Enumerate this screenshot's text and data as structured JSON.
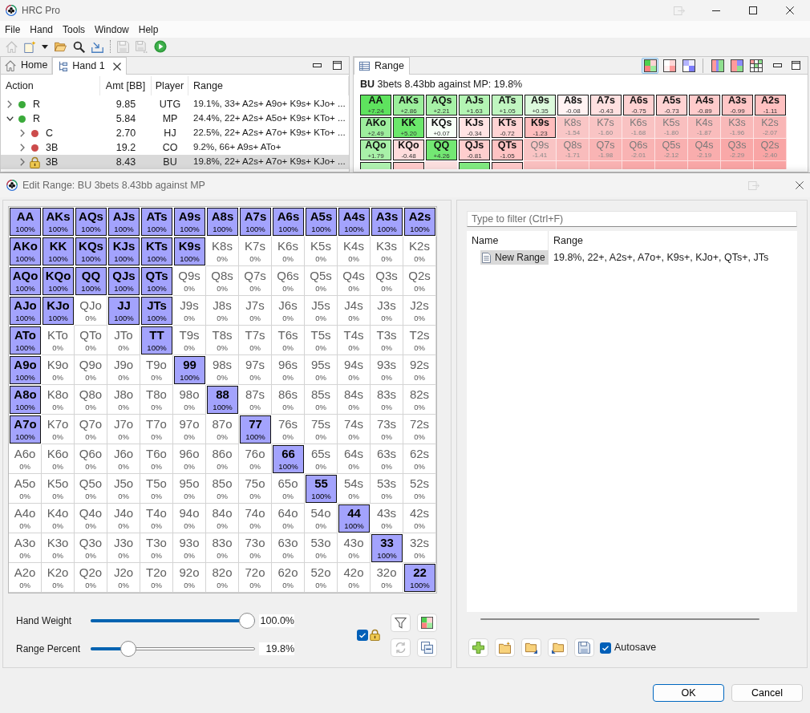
{
  "window": {
    "title": "HRC Pro"
  },
  "menu": [
    "File",
    "Hand",
    "Tools",
    "Window",
    "Help"
  ],
  "toolbar": [
    [
      {
        "kind": "home",
        "disabled": true
      },
      {
        "kind": "new",
        "disabled": false
      },
      {
        "kind": "menu-arrow",
        "disabled": false
      },
      {
        "kind": "open",
        "disabled": false
      },
      {
        "kind": "search",
        "disabled": false
      },
      {
        "kind": "import",
        "disabled": false
      }
    ],
    [
      {
        "kind": "save",
        "disabled": true
      },
      {
        "kind": "save-all",
        "disabled": true
      },
      {
        "kind": "run",
        "disabled": false
      }
    ]
  ],
  "hand_panel": {
    "tabs": [
      {
        "label": "Home",
        "kind": "home",
        "selected": false,
        "closable": false
      },
      {
        "label": "Hand 1",
        "kind": "tree",
        "selected": true,
        "closable": true
      }
    ],
    "columns": [
      "Action",
      "Amt [BB]",
      "Player",
      "Range"
    ],
    "rows": [
      {
        "action": "R",
        "amount": "9.85",
        "player": "UTG",
        "range": "19.1%, 33+ A2s+ A9o+ K9s+ KJo+ ...",
        "kind": "dot",
        "color": "#3aaa3a",
        "expanded": false,
        "selected": false
      },
      {
        "action": "R",
        "amount": "5.84",
        "player": "MP",
        "range": "24.4%, 22+ A2s+ A5o+ K9s+ KTo+ ...",
        "kind": "dot",
        "color": "#3aaa3a",
        "expanded": true,
        "selected": false,
        "children": [
          {
            "action": "C",
            "amount": "2.70",
            "player": "HJ",
            "range": "22.5%, 22+ A2s+ A7o+ K9s+ KTo+ ...",
            "kind": "dot",
            "color": "#cc4b4b",
            "expanded": false,
            "selected": false
          },
          {
            "action": "3B",
            "amount": "19.2",
            "player": "CO",
            "range": "9.2%, 66+ A9s+ ATo+",
            "kind": "dot",
            "color": "#cc4b4b",
            "expanded": false,
            "selected": false
          },
          {
            "action": "3B",
            "amount": "8.43",
            "player": "BU",
            "range": "19.8%, 22+ A2s+ A7o+ K9s+ KJo+ ...",
            "kind": "lock",
            "expanded": false,
            "selected": true
          }
        ]
      }
    ]
  },
  "range_panel": {
    "tab": {
      "label": "Range",
      "kind": "table",
      "selected": true
    },
    "view_groups": [
      [
        {
          "kind": "ev",
          "selected": true
        },
        {
          "kind": "frequency",
          "selected": false
        },
        {
          "kind": "weight",
          "selected": false
        }
      ],
      [
        {
          "kind": "split",
          "selected": false
        },
        {
          "kind": "compare",
          "selected": false
        },
        {
          "kind": "matrix",
          "selected": false
        }
      ]
    ],
    "headline": "**BU** 3bets 8.43bb against MP: 19.8%",
    "grid": [
      [
        {
          "hand": "AA",
          "ev": "+7.24",
          "in_range": true,
          "color": "#5ee35e"
        },
        {
          "hand": "AKs",
          "ev": "+2.86",
          "in_range": true,
          "color": "#9bef9b"
        },
        {
          "hand": "AQs",
          "ev": "+2.21",
          "in_range": true,
          "color": "#a6f1a6"
        },
        {
          "hand": "AJs",
          "ev": "+1.63",
          "in_range": true,
          "color": "#b3f4b3"
        },
        {
          "hand": "ATs",
          "ev": "+1.05",
          "in_range": true,
          "color": "#c0f6c0"
        },
        {
          "hand": "A9s",
          "ev": "+0.35",
          "in_range": true,
          "color": "#dcfadc"
        },
        {
          "hand": "A8s",
          "ev": "-0.08",
          "in_range": true,
          "color": "#fff2f2"
        },
        {
          "hand": "A7s",
          "ev": "-0.43",
          "in_range": true,
          "color": "#ffe0e0"
        },
        {
          "hand": "A6s",
          "ev": "-0.75",
          "in_range": true,
          "color": "#ffd2d2"
        },
        {
          "hand": "A5s",
          "ev": "-0.73",
          "in_range": true,
          "color": "#ffd3d3"
        },
        {
          "hand": "A4s",
          "ev": "-0.89",
          "in_range": true,
          "color": "#ffcbcb"
        },
        {
          "hand": "A3s",
          "ev": "-0.99",
          "in_range": true,
          "color": "#ffc6c6"
        },
        {
          "hand": "A2s",
          "ev": "-1.11",
          "in_range": true,
          "color": "#ffc1c1"
        }
      ],
      [
        {
          "hand": "AKo",
          "ev": "+2.49",
          "in_range": true,
          "color": "#9eef9e"
        },
        {
          "hand": "KK",
          "ev": "+5.20",
          "in_range": true,
          "color": "#6be86b"
        },
        {
          "hand": "KQs",
          "ev": "+0.07",
          "in_range": true,
          "color": "#f6fff6"
        },
        {
          "hand": "KJs",
          "ev": "-0.34",
          "in_range": true,
          "color": "#ffe4e4"
        },
        {
          "hand": "KTs",
          "ev": "-0.72",
          "in_range": true,
          "color": "#ffd4d4"
        },
        {
          "hand": "K9s",
          "ev": "-1.23",
          "in_range": true,
          "color": "#ffbdbd"
        },
        {
          "hand": "K8s",
          "ev": "-1.54",
          "in_range": false,
          "color": "#f9c6c6"
        },
        {
          "hand": "K7s",
          "ev": "-1.60",
          "in_range": false,
          "color": "#f9c4c4"
        },
        {
          "hand": "K6s",
          "ev": "-1.68",
          "in_range": false,
          "color": "#f9c2c2"
        },
        {
          "hand": "K5s",
          "ev": "-1.80",
          "in_range": false,
          "color": "#f9bfbf"
        },
        {
          "hand": "K4s",
          "ev": "-1.87",
          "in_range": false,
          "color": "#f9bcbc"
        },
        {
          "hand": "K3s",
          "ev": "-1.96",
          "in_range": false,
          "color": "#f9b9b9"
        },
        {
          "hand": "K2s",
          "ev": "-2.07",
          "in_range": false,
          "color": "#f9b6b6"
        }
      ],
      [
        {
          "hand": "AQo",
          "ev": "+1.79",
          "in_range": true,
          "color": "#a8f1a8"
        },
        {
          "hand": "KQo",
          "ev": "-0.48",
          "in_range": true,
          "color": "#ffdcdc"
        },
        {
          "hand": "QQ",
          "ev": "+4.26",
          "in_range": true,
          "color": "#73e873"
        },
        {
          "hand": "QJs",
          "ev": "-0.81",
          "in_range": true,
          "color": "#ffcece"
        },
        {
          "hand": "QTs",
          "ev": "-1.05",
          "in_range": true,
          "color": "#ffc3c3"
        },
        {
          "hand": "Q9s",
          "ev": "-1.41",
          "in_range": false,
          "color": "#f9c4c4"
        },
        {
          "hand": "Q8s",
          "ev": "-1.71",
          "in_range": false,
          "color": "#f9bcbc"
        },
        {
          "hand": "Q7s",
          "ev": "-1.98",
          "in_range": false,
          "color": "#f9b4b4"
        },
        {
          "hand": "Q6s",
          "ev": "-2.01",
          "in_range": false,
          "color": "#f9b3b3"
        },
        {
          "hand": "Q5s",
          "ev": "-2.12",
          "in_range": false,
          "color": "#f9b0b0"
        },
        {
          "hand": "Q4s",
          "ev": "-2.19",
          "in_range": false,
          "color": "#f9adad"
        },
        {
          "hand": "Q3s",
          "ev": "-2.29",
          "in_range": false,
          "color": "#f9a8a8"
        },
        {
          "hand": "Q2s",
          "ev": "-2.40",
          "in_range": false,
          "color": "#f9a5a5"
        }
      ],
      [
        {
          "in_range": true,
          "color": "#b0f2b0"
        },
        {
          "in_range": true,
          "color": "#ffcaca"
        },
        {
          "in_range": false,
          "color": "#fbdede"
        },
        {
          "in_range": true,
          "color": "#80ea80"
        },
        {
          "in_range": true,
          "color": "#ffc8c8"
        },
        {
          "in_range": false,
          "color": "#f9bfbf"
        },
        {
          "in_range": false,
          "color": "#f9b8b8"
        },
        {
          "in_range": false,
          "color": "#f9b2b2"
        },
        {
          "in_range": false,
          "color": "#f9aaaa"
        },
        {
          "in_range": false,
          "color": "#f9aaaa"
        },
        {
          "in_range": false,
          "color": "#f9a7a7"
        },
        {
          "in_range": false,
          "color": "#f9a5a5"
        },
        {
          "in_range": false,
          "color": "#f9a3a3"
        }
      ]
    ]
  },
  "dialog": {
    "title": "Edit Range: BU 3bets 8.43bb against MP",
    "grid": [
      [
        {
          "hand": "AA",
          "weight": "100%",
          "selected": true
        },
        {
          "hand": "AKs",
          "weight": "100%",
          "selected": true
        },
        {
          "hand": "AQs",
          "weight": "100%",
          "selected": true
        },
        {
          "hand": "AJs",
          "weight": "100%",
          "selected": true
        },
        {
          "hand": "ATs",
          "weight": "100%",
          "selected": true
        },
        {
          "hand": "A9s",
          "weight": "100%",
          "selected": true
        },
        {
          "hand": "A8s",
          "weight": "100%",
          "selected": true
        },
        {
          "hand": "A7s",
          "weight": "100%",
          "selected": true
        },
        {
          "hand": "A6s",
          "weight": "100%",
          "selected": true
        },
        {
          "hand": "A5s",
          "weight": "100%",
          "selected": true
        },
        {
          "hand": "A4s",
          "weight": "100%",
          "selected": true
        },
        {
          "hand": "A3s",
          "weight": "100%",
          "selected": true
        },
        {
          "hand": "A2s",
          "weight": "100%",
          "selected": true
        }
      ],
      [
        {
          "hand": "AKo",
          "weight": "100%",
          "selected": true
        },
        {
          "hand": "KK",
          "weight": "100%",
          "selected": true
        },
        {
          "hand": "KQs",
          "weight": "100%",
          "selected": true
        },
        {
          "hand": "KJs",
          "weight": "100%",
          "selected": true
        },
        {
          "hand": "KTs",
          "weight": "100%",
          "selected": true
        },
        {
          "hand": "K9s",
          "weight": "100%",
          "selected": true
        },
        {
          "hand": "K8s",
          "weight": "0%",
          "selected": false
        },
        {
          "hand": "K7s",
          "weight": "0%",
          "selected": false
        },
        {
          "hand": "K6s",
          "weight": "0%",
          "selected": false
        },
        {
          "hand": "K5s",
          "weight": "0%",
          "selected": false
        },
        {
          "hand": "K4s",
          "weight": "0%",
          "selected": false
        },
        {
          "hand": "K3s",
          "weight": "0%",
          "selected": false
        },
        {
          "hand": "K2s",
          "weight": "0%",
          "selected": false
        }
      ],
      [
        {
          "hand": "AQo",
          "weight": "100%",
          "selected": true
        },
        {
          "hand": "KQo",
          "weight": "100%",
          "selected": true
        },
        {
          "hand": "QQ",
          "weight": "100%",
          "selected": true
        },
        {
          "hand": "QJs",
          "weight": "100%",
          "selected": true
        },
        {
          "hand": "QTs",
          "weight": "100%",
          "selected": true
        },
        {
          "hand": "Q9s",
          "weight": "0%",
          "selected": false
        },
        {
          "hand": "Q8s",
          "weight": "0%",
          "selected": false
        },
        {
          "hand": "Q7s",
          "weight": "0%",
          "selected": false
        },
        {
          "hand": "Q6s",
          "weight": "0%",
          "selected": false
        },
        {
          "hand": "Q5s",
          "weight": "0%",
          "selected": false
        },
        {
          "hand": "Q4s",
          "weight": "0%",
          "selected": false
        },
        {
          "hand": "Q3s",
          "weight": "0%",
          "selected": false
        },
        {
          "hand": "Q2s",
          "weight": "0%",
          "selected": false
        }
      ],
      [
        {
          "hand": "AJo",
          "weight": "100%",
          "selected": true
        },
        {
          "hand": "KJo",
          "weight": "100%",
          "selected": true
        },
        {
          "hand": "QJo",
          "weight": "0%",
          "selected": false
        },
        {
          "hand": "JJ",
          "weight": "100%",
          "selected": true
        },
        {
          "hand": "JTs",
          "weight": "100%",
          "selected": true
        },
        {
          "hand": "J9s",
          "weight": "0%",
          "selected": false
        },
        {
          "hand": "J8s",
          "weight": "0%",
          "selected": false
        },
        {
          "hand": "J7s",
          "weight": "0%",
          "selected": false
        },
        {
          "hand": "J6s",
          "weight": "0%",
          "selected": false
        },
        {
          "hand": "J5s",
          "weight": "0%",
          "selected": false
        },
        {
          "hand": "J4s",
          "weight": "0%",
          "selected": false
        },
        {
          "hand": "J3s",
          "weight": "0%",
          "selected": false
        },
        {
          "hand": "J2s",
          "weight": "0%",
          "selected": false
        }
      ],
      [
        {
          "hand": "ATo",
          "weight": "100%",
          "selected": true
        },
        {
          "hand": "KTo",
          "weight": "0%",
          "selected": false
        },
        {
          "hand": "QTo",
          "weight": "0%",
          "selected": false
        },
        {
          "hand": "JTo",
          "weight": "0%",
          "selected": false
        },
        {
          "hand": "TT",
          "weight": "100%",
          "selected": true
        },
        {
          "hand": "T9s",
          "weight": "0%",
          "selected": false
        },
        {
          "hand": "T8s",
          "weight": "0%",
          "selected": false
        },
        {
          "hand": "T7s",
          "weight": "0%",
          "selected": false
        },
        {
          "hand": "T6s",
          "weight": "0%",
          "selected": false
        },
        {
          "hand": "T5s",
          "weight": "0%",
          "selected": false
        },
        {
          "hand": "T4s",
          "weight": "0%",
          "selected": false
        },
        {
          "hand": "T3s",
          "weight": "0%",
          "selected": false
        },
        {
          "hand": "T2s",
          "weight": "0%",
          "selected": false
        }
      ],
      [
        {
          "hand": "A9o",
          "weight": "100%",
          "selected": true
        },
        {
          "hand": "K9o",
          "weight": "0%",
          "selected": false
        },
        {
          "hand": "Q9o",
          "weight": "0%",
          "selected": false
        },
        {
          "hand": "J9o",
          "weight": "0%",
          "selected": false
        },
        {
          "hand": "T9o",
          "weight": "0%",
          "selected": false
        },
        {
          "hand": "99",
          "weight": "100%",
          "selected": true
        },
        {
          "hand": "98s",
          "weight": "0%",
          "selected": false
        },
        {
          "hand": "97s",
          "weight": "0%",
          "selected": false
        },
        {
          "hand": "96s",
          "weight": "0%",
          "selected": false
        },
        {
          "hand": "95s",
          "weight": "0%",
          "selected": false
        },
        {
          "hand": "94s",
          "weight": "0%",
          "selected": false
        },
        {
          "hand": "93s",
          "weight": "0%",
          "selected": false
        },
        {
          "hand": "92s",
          "weight": "0%",
          "selected": false
        }
      ],
      [
        {
          "hand": "A8o",
          "weight": "100%",
          "selected": true
        },
        {
          "hand": "K8o",
          "weight": "0%",
          "selected": false
        },
        {
          "hand": "Q8o",
          "weight": "0%",
          "selected": false
        },
        {
          "hand": "J8o",
          "weight": "0%",
          "selected": false
        },
        {
          "hand": "T8o",
          "weight": "0%",
          "selected": false
        },
        {
          "hand": "98o",
          "weight": "0%",
          "selected": false
        },
        {
          "hand": "88",
          "weight": "100%",
          "selected": true
        },
        {
          "hand": "87s",
          "weight": "0%",
          "selected": false
        },
        {
          "hand": "86s",
          "weight": "0%",
          "selected": false
        },
        {
          "hand": "85s",
          "weight": "0%",
          "selected": false
        },
        {
          "hand": "84s",
          "weight": "0%",
          "selected": false
        },
        {
          "hand": "83s",
          "weight": "0%",
          "selected": false
        },
        {
          "hand": "82s",
          "weight": "0%",
          "selected": false
        }
      ],
      [
        {
          "hand": "A7o",
          "weight": "100%",
          "selected": true
        },
        {
          "hand": "K7o",
          "weight": "0%",
          "selected": false
        },
        {
          "hand": "Q7o",
          "weight": "0%",
          "selected": false
        },
        {
          "hand": "J7o",
          "weight": "0%",
          "selected": false
        },
        {
          "hand": "T7o",
          "weight": "0%",
          "selected": false
        },
        {
          "hand": "97o",
          "weight": "0%",
          "selected": false
        },
        {
          "hand": "87o",
          "weight": "0%",
          "selected": false
        },
        {
          "hand": "77",
          "weight": "100%",
          "selected": true
        },
        {
          "hand": "76s",
          "weight": "0%",
          "selected": false
        },
        {
          "hand": "75s",
          "weight": "0%",
          "selected": false
        },
        {
          "hand": "74s",
          "weight": "0%",
          "selected": false
        },
        {
          "hand": "73s",
          "weight": "0%",
          "selected": false
        },
        {
          "hand": "72s",
          "weight": "0%",
          "selected": false
        }
      ],
      [
        {
          "hand": "A6o",
          "weight": "0%",
          "selected": false
        },
        {
          "hand": "K6o",
          "weight": "0%",
          "selected": false
        },
        {
          "hand": "Q6o",
          "weight": "0%",
          "selected": false
        },
        {
          "hand": "J6o",
          "weight": "0%",
          "selected": false
        },
        {
          "hand": "T6o",
          "weight": "0%",
          "selected": false
        },
        {
          "hand": "96o",
          "weight": "0%",
          "selected": false
        },
        {
          "hand": "86o",
          "weight": "0%",
          "selected": false
        },
        {
          "hand": "76o",
          "weight": "0%",
          "selected": false
        },
        {
          "hand": "66",
          "weight": "100%",
          "selected": true
        },
        {
          "hand": "65s",
          "weight": "0%",
          "selected": false
        },
        {
          "hand": "64s",
          "weight": "0%",
          "selected": false
        },
        {
          "hand": "63s",
          "weight": "0%",
          "selected": false
        },
        {
          "hand": "62s",
          "weight": "0%",
          "selected": false
        }
      ],
      [
        {
          "hand": "A5o",
          "weight": "0%",
          "selected": false
        },
        {
          "hand": "K5o",
          "weight": "0%",
          "selected": false
        },
        {
          "hand": "Q5o",
          "weight": "0%",
          "selected": false
        },
        {
          "hand": "J5o",
          "weight": "0%",
          "selected": false
        },
        {
          "hand": "T5o",
          "weight": "0%",
          "selected": false
        },
        {
          "hand": "95o",
          "weight": "0%",
          "selected": false
        },
        {
          "hand": "85o",
          "weight": "0%",
          "selected": false
        },
        {
          "hand": "75o",
          "weight": "0%",
          "selected": false
        },
        {
          "hand": "65o",
          "weight": "0%",
          "selected": false
        },
        {
          "hand": "55",
          "weight": "100%",
          "selected": true
        },
        {
          "hand": "54s",
          "weight": "0%",
          "selected": false
        },
        {
          "hand": "53s",
          "weight": "0%",
          "selected": false
        },
        {
          "hand": "52s",
          "weight": "0%",
          "selected": false
        }
      ],
      [
        {
          "hand": "A4o",
          "weight": "0%",
          "selected": false
        },
        {
          "hand": "K4o",
          "weight": "0%",
          "selected": false
        },
        {
          "hand": "Q4o",
          "weight": "0%",
          "selected": false
        },
        {
          "hand": "J4o",
          "weight": "0%",
          "selected": false
        },
        {
          "hand": "T4o",
          "weight": "0%",
          "selected": false
        },
        {
          "hand": "94o",
          "weight": "0%",
          "selected": false
        },
        {
          "hand": "84o",
          "weight": "0%",
          "selected": false
        },
        {
          "hand": "74o",
          "weight": "0%",
          "selected": false
        },
        {
          "hand": "64o",
          "weight": "0%",
          "selected": false
        },
        {
          "hand": "54o",
          "weight": "0%",
          "selected": false
        },
        {
          "hand": "44",
          "weight": "100%",
          "selected": true
        },
        {
          "hand": "43s",
          "weight": "0%",
          "selected": false
        },
        {
          "hand": "42s",
          "weight": "0%",
          "selected": false
        }
      ],
      [
        {
          "hand": "A3o",
          "weight": "0%",
          "selected": false
        },
        {
          "hand": "K3o",
          "weight": "0%",
          "selected": false
        },
        {
          "hand": "Q3o",
          "weight": "0%",
          "selected": false
        },
        {
          "hand": "J3o",
          "weight": "0%",
          "selected": false
        },
        {
          "hand": "T3o",
          "weight": "0%",
          "selected": false
        },
        {
          "hand": "93o",
          "weight": "0%",
          "selected": false
        },
        {
          "hand": "83o",
          "weight": "0%",
          "selected": false
        },
        {
          "hand": "73o",
          "weight": "0%",
          "selected": false
        },
        {
          "hand": "63o",
          "weight": "0%",
          "selected": false
        },
        {
          "hand": "53o",
          "weight": "0%",
          "selected": false
        },
        {
          "hand": "43o",
          "weight": "0%",
          "selected": false
        },
        {
          "hand": "33",
          "weight": "100%",
          "selected": true
        },
        {
          "hand": "32s",
          "weight": "0%",
          "selected": false
        }
      ],
      [
        {
          "hand": "A2o",
          "weight": "0%",
          "selected": false
        },
        {
          "hand": "K2o",
          "weight": "0%",
          "selected": false
        },
        {
          "hand": "Q2o",
          "weight": "0%",
          "selected": false
        },
        {
          "hand": "J2o",
          "weight": "0%",
          "selected": false
        },
        {
          "hand": "T2o",
          "weight": "0%",
          "selected": false
        },
        {
          "hand": "92o",
          "weight": "0%",
          "selected": false
        },
        {
          "hand": "82o",
          "weight": "0%",
          "selected": false
        },
        {
          "hand": "72o",
          "weight": "0%",
          "selected": false
        },
        {
          "hand": "62o",
          "weight": "0%",
          "selected": false
        },
        {
          "hand": "52o",
          "weight": "0%",
          "selected": false
        },
        {
          "hand": "42o",
          "weight": "0%",
          "selected": false
        },
        {
          "hand": "32o",
          "weight": "0%",
          "selected": false
        },
        {
          "hand": "22",
          "weight": "100%",
          "selected": true
        }
      ]
    ],
    "sliders": [
      {
        "label": "Hand Weight",
        "level": 1,
        "reading": "100.0%"
      },
      {
        "label": "Range Percent",
        "level": 0.198,
        "reading": "19.8%"
      }
    ],
    "weight_lock": {
      "checked": true
    },
    "tool_buttons": [
      {
        "kind": "filter",
        "disabled": false
      },
      {
        "kind": "colors",
        "disabled": false
      },
      {
        "kind": "swap",
        "disabled": true
      },
      {
        "kind": "collapse",
        "disabled": false
      }
    ],
    "filter": {
      "placeholder": "Type to filter (Ctrl+F)"
    },
    "saved_ranges": {
      "columns": [
        "Name",
        "Range"
      ],
      "rows": [
        {
          "name": "New Range",
          "range": "19.8%, 22+, A2s+, A7o+, K9s+, KJo+, QTs+, JTs",
          "selected": true
        }
      ]
    },
    "file_buttons": [
      {
        "kind": "add",
        "disabled": false
      },
      {
        "kind": "new-folder",
        "disabled": false
      },
      {
        "kind": "import",
        "disabled": false
      },
      {
        "kind": "export",
        "disabled": false
      },
      {
        "kind": "save",
        "disabled": false
      }
    ],
    "autosave": {
      "label": "Autosave",
      "checked": true
    },
    "buttons": [
      {
        "label": "OK",
        "default": true
      },
      {
        "label": "Cancel",
        "default": false
      }
    ]
  }
}
